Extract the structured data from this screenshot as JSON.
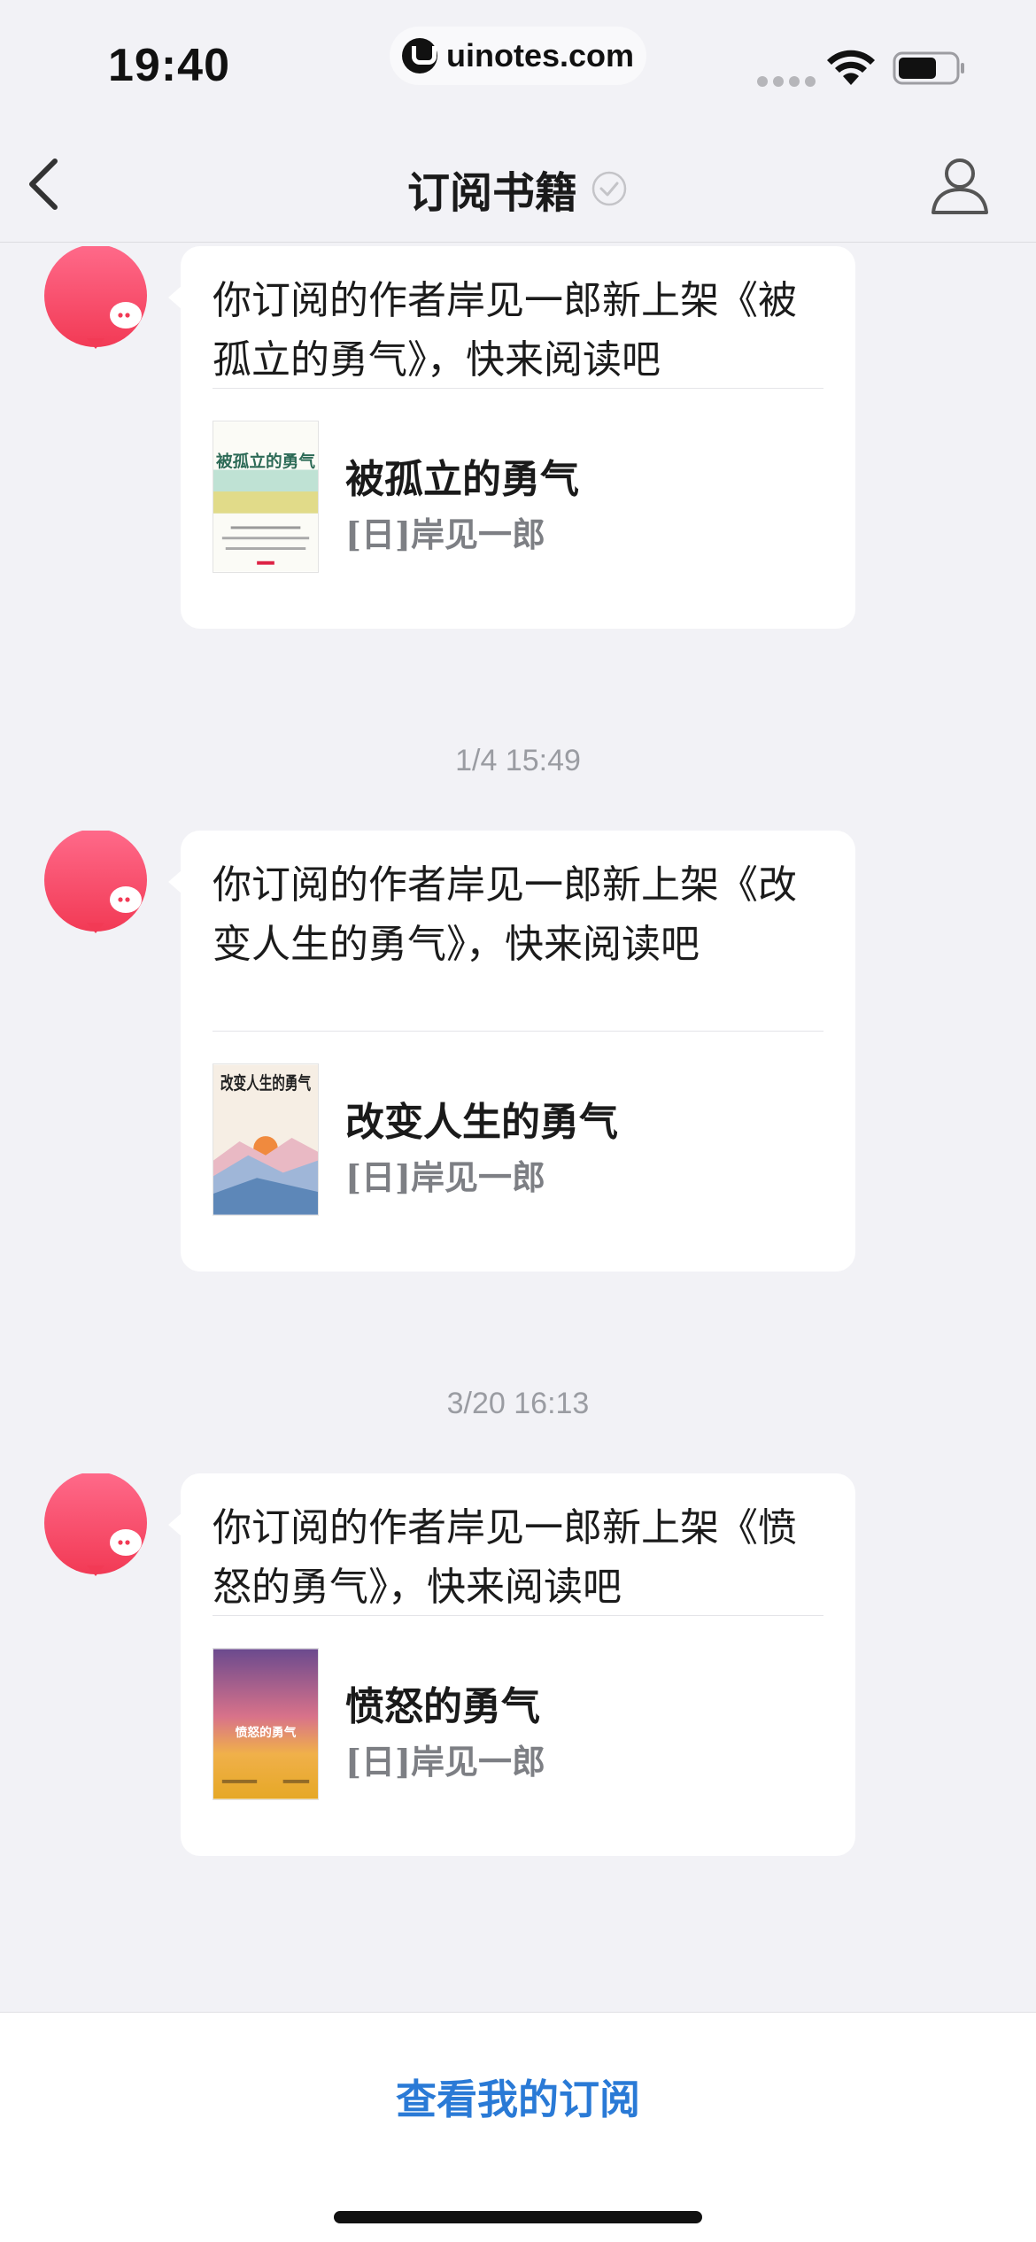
{
  "status_bar": {
    "time": "19:40",
    "watermark": "uinotes.com"
  },
  "nav": {
    "title": "订阅书籍"
  },
  "messages": [
    {
      "text": "你订阅的作者岸见一郎新上架《被孤立的勇气》，快来阅读吧",
      "book_title": "被孤立的勇气",
      "book_author": "[日]岸见一郎",
      "cover_title": "被孤立的勇气"
    },
    {
      "timestamp": "1/4 15:49",
      "text": "你订阅的作者岸见一郎新上架《改变人生的勇气》，快来阅读吧",
      "book_title": "改变人生的勇气",
      "book_author": "[日]岸见一郎",
      "cover_title": "改变人生的勇气"
    },
    {
      "timestamp": "3/20 16:13",
      "text": "你订阅的作者岸见一郎新上架《愤怒的勇气》，快来阅读吧",
      "book_title": "愤怒的勇气",
      "book_author": "[日]岸见一郎",
      "cover_title": "愤怒的勇气"
    }
  ],
  "footer": {
    "view_subscriptions": "查看我的订阅"
  },
  "colors": {
    "accent_link": "#2a7ad6",
    "avatar_gradient_top": "#ff6a8a",
    "avatar_gradient_bottom": "#f23a55",
    "background": "#f2f2f6"
  }
}
